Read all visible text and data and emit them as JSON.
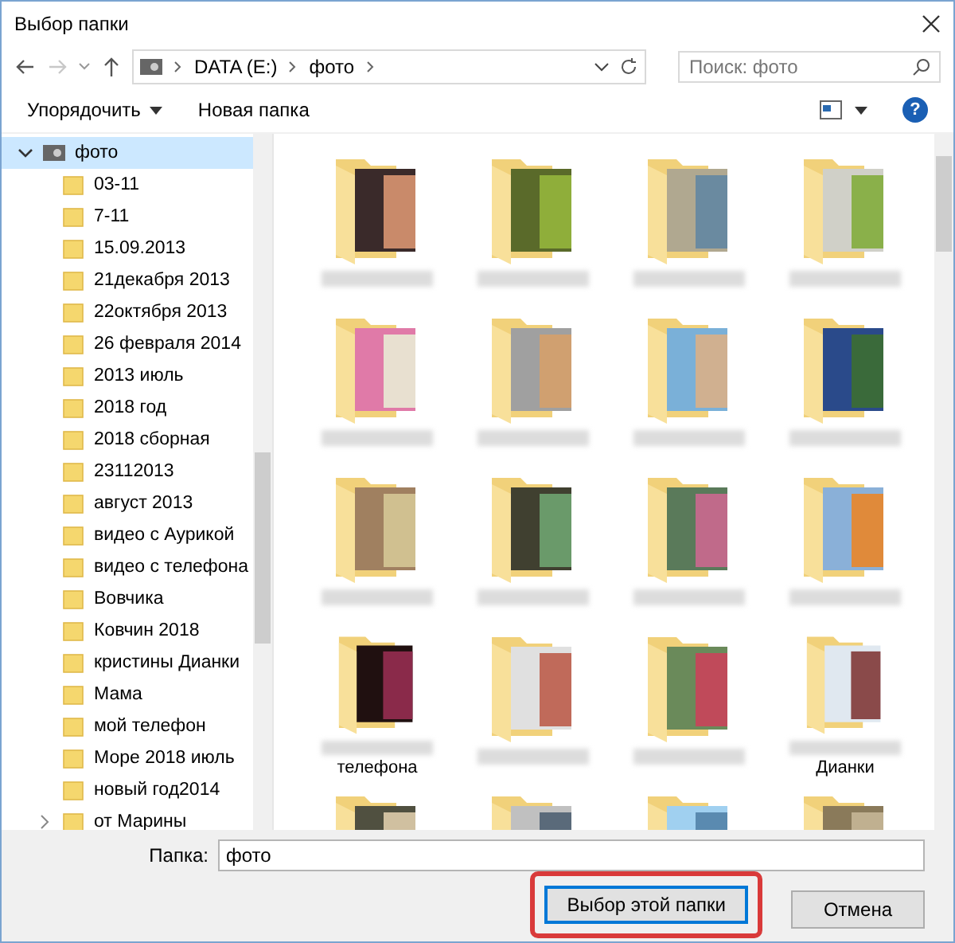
{
  "window": {
    "title": "Выбор папки"
  },
  "address_bar": {
    "segments": [
      "DATA (E:)",
      "фото"
    ]
  },
  "search": {
    "placeholder": "Поиск: фото"
  },
  "toolbar": {
    "organize": "Упорядочить",
    "new_folder": "Новая папка",
    "help": "?"
  },
  "tree": {
    "label": "фото",
    "expanded": true,
    "selected": true,
    "children": [
      {
        "label": "03-11",
        "has_children": false
      },
      {
        "label": "7-11",
        "has_children": false
      },
      {
        "label": "15.09.2013",
        "has_children": false
      },
      {
        "label": "21декабря 2013",
        "has_children": false
      },
      {
        "label": "22октября 2013",
        "has_children": false
      },
      {
        "label": "26 февраля 2014",
        "has_children": false
      },
      {
        "label": "2013 июль",
        "has_children": false
      },
      {
        "label": "2018 год",
        "has_children": false
      },
      {
        "label": "2018 сборная",
        "has_children": false
      },
      {
        "label": "23112013",
        "has_children": false
      },
      {
        "label": "август 2013",
        "has_children": false
      },
      {
        "label": "видео с Аурикой",
        "has_children": false
      },
      {
        "label": "видео с телефона",
        "has_children": false
      },
      {
        "label": "Вовчика",
        "has_children": false
      },
      {
        "label": "Ковчин 2018",
        "has_children": false
      },
      {
        "label": "кристины Дианки",
        "has_children": false
      },
      {
        "label": "Мама",
        "has_children": false
      },
      {
        "label": "мой телефон",
        "has_children": false
      },
      {
        "label": "Море 2018 июль",
        "has_children": false
      },
      {
        "label": "новый год2014",
        "has_children": false
      },
      {
        "label": "от Марины",
        "has_children": true
      }
    ]
  },
  "folders": [
    {
      "kind": "photos"
    },
    {
      "kind": "photos"
    },
    {
      "kind": "photos"
    },
    {
      "kind": "photos"
    },
    {
      "kind": "photos"
    },
    {
      "kind": "photos"
    },
    {
      "kind": "photos"
    },
    {
      "kind": "photos"
    },
    {
      "kind": "photos"
    },
    {
      "kind": "photos"
    },
    {
      "kind": "photos"
    },
    {
      "kind": "photos"
    },
    {
      "kind": "photos",
      "label": "телефона"
    },
    {
      "kind": "photos"
    },
    {
      "kind": "photos"
    },
    {
      "kind": "photos",
      "label": "Дианки"
    },
    {
      "kind": "photos"
    },
    {
      "kind": "photos"
    },
    {
      "kind": "photos"
    },
    {
      "kind": "photos"
    }
  ],
  "folder_field": {
    "label": "Папка:",
    "value": "фото"
  },
  "buttons": [
    {
      "label": "Выбор этой папки",
      "kind": "primary",
      "highlighted": true
    },
    {
      "label": "Отмена",
      "kind": "secondary",
      "highlighted": false
    }
  ]
}
